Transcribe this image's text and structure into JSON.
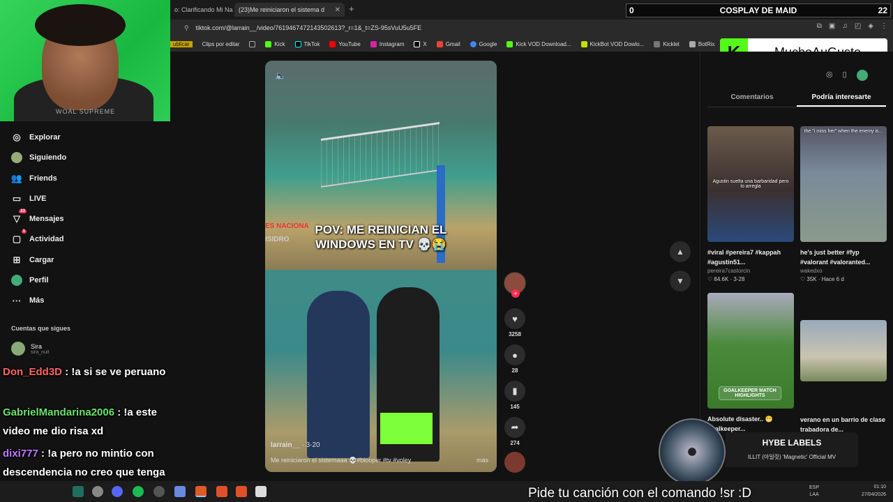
{
  "browser": {
    "tabs": [
      {
        "title": "o: Clarificando Mi Na"
      },
      {
        "title": "(23)Me reiniciaron el sistema d"
      }
    ],
    "new_tab": "+",
    "url": "tiktok.com/@larrain__/video/7619467472143502613?_r=1&_t=ZS-95sVuU5u5FE",
    "bookmarks": [
      "ublicar",
      "Clips por editar",
      "Kick",
      "TikTok",
      "YouTube",
      "Instagram",
      "X",
      "Gmail",
      "Google",
      "Kick VOD Download...",
      "KickBot VOD Dowlo...",
      "Kicklet",
      "BotRix"
    ]
  },
  "overlay": {
    "score_left": "0",
    "score_title": "COSPLAY DE MAID",
    "score_right": "22",
    "kick_channel": "MuchoAuGusto",
    "webcam_shirt": "WOAL SUPREME",
    "song_request": "Pide tu canción con el comando !sr :D",
    "now_playing_title": "HYBE LABELS",
    "now_playing_song": "ILLIT (아일릿) 'Magnetic' Official MV"
  },
  "nav": {
    "items": [
      {
        "label": "Explorar",
        "icon": "compass-icon"
      },
      {
        "label": "Siguiendo",
        "icon": "following-icon"
      },
      {
        "label": "Friends",
        "icon": "friends-icon"
      },
      {
        "label": "LIVE",
        "icon": "live-icon"
      },
      {
        "label": "Mensajes",
        "icon": "messages-icon",
        "badge": "23"
      },
      {
        "label": "Actividad",
        "icon": "activity-icon",
        "badge": "1"
      },
      {
        "label": "Cargar",
        "icon": "upload-icon"
      },
      {
        "label": "Perfil",
        "icon": "profile-icon"
      },
      {
        "label": "Más",
        "icon": "more-icon"
      }
    ],
    "following_title": "Cuentas que sigues",
    "following": [
      {
        "name": "Sira",
        "handle": "sira_nuit"
      }
    ]
  },
  "chat": [
    {
      "user": "Don_Edd3D",
      "text": ": !a si se ve peruano"
    },
    {
      "user": "GabrielMandarina2006",
      "text": ": !a este video me dio risa xd"
    },
    {
      "user": "dixi777",
      "text": ": !a pero no mintio con descendencia no creo que tenga hijos"
    }
  ],
  "video": {
    "caption_line1": "POV: ME REINICIAN EL",
    "caption_line2": "WINDOWS EN TV 💀😭",
    "banner": "ES NACIONA",
    "banner2": "ISIDRO",
    "author": "larrain__",
    "date": "· 3-20",
    "description": "Me reiniciaron el sistemaaa 💀#blooper #tv #voley",
    "more": "más"
  },
  "actions": {
    "likes": "3258",
    "comments": "28",
    "saves": "145",
    "shares": "274"
  },
  "right_panel": {
    "tab_comments": "Comentarios",
    "tab_recommended": "Podría interesarte",
    "cards": [
      {
        "title": "#viral #pereira7 #kappah #agustin51...",
        "user": "pereira7castorcin",
        "likes": "84.6K",
        "date": "3-28",
        "overlay": "Agustin suelta una barbaridad pero lo arregla"
      },
      {
        "title": "he's just better #fyp #valorant #valoranted...",
        "user": "wakedxo",
        "likes": "35K",
        "date": "Hace 6 d",
        "overlay": "the \"i miss her\" when the enemy is..."
      },
      {
        "title": "Absolute disaster.. 😬 goalkeeper...",
        "label": "GOALKEEPER MATCH HIGHLIGHTS"
      },
      {
        "title": "verano en un barrio de clase trabadora de..."
      }
    ]
  },
  "taskbar": {
    "lang": "ESP",
    "lang_sub": "LAA",
    "time": "01:10",
    "date": "27/04/2026"
  }
}
